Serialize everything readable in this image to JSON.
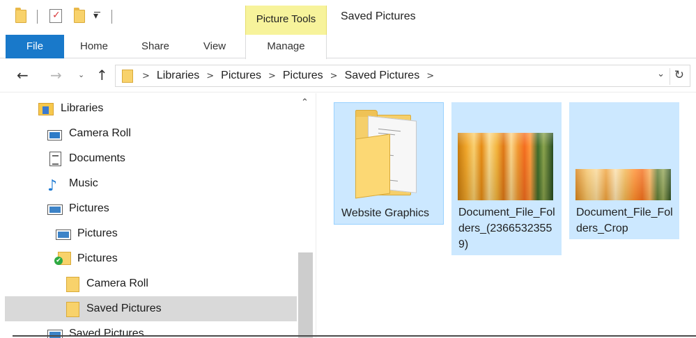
{
  "window": {
    "title": "Saved Pictures",
    "context_tab_group": "Picture Tools"
  },
  "ribbon": {
    "tabs": [
      {
        "label": "File",
        "active": true
      },
      {
        "label": "Home"
      },
      {
        "label": "Share"
      },
      {
        "label": "View"
      },
      {
        "label": "Manage"
      }
    ]
  },
  "address": {
    "breadcrumbs": [
      "Libraries",
      "Pictures",
      "Pictures",
      "Saved Pictures"
    ],
    "separator": ">"
  },
  "nav_pane": {
    "items": [
      {
        "label": "Libraries",
        "icon": "libraries-icon"
      },
      {
        "label": "Camera Roll",
        "icon": "camera-roll-library-icon"
      },
      {
        "label": "Documents",
        "icon": "documents-library-icon"
      },
      {
        "label": "Music",
        "icon": "music-library-icon"
      },
      {
        "label": "Pictures",
        "icon": "pictures-library-icon"
      },
      {
        "label": "Pictures",
        "icon": "pictures-location-icon"
      },
      {
        "label": "Pictures",
        "icon": "synced-folder-icon"
      },
      {
        "label": "Camera Roll",
        "icon": "folder-icon"
      },
      {
        "label": "Saved Pictures",
        "icon": "folder-icon",
        "selected": true
      },
      {
        "label": "Saved Pictures",
        "icon": "saved-pictures-library-icon"
      }
    ]
  },
  "files": [
    {
      "name": "Website Graphics",
      "type": "folder",
      "selected": true,
      "focused": true
    },
    {
      "name": "Document_File_Folders_(23665323559)",
      "type": "image",
      "selected": true
    },
    {
      "name": "Document_File_Folders_Crop",
      "type": "image",
      "selected": true
    }
  ],
  "colors": {
    "file_tab": "#1979ca",
    "context_tab": "#f7f39b",
    "selection": "#cce8ff",
    "nav_selected": "#d9d9d9"
  }
}
